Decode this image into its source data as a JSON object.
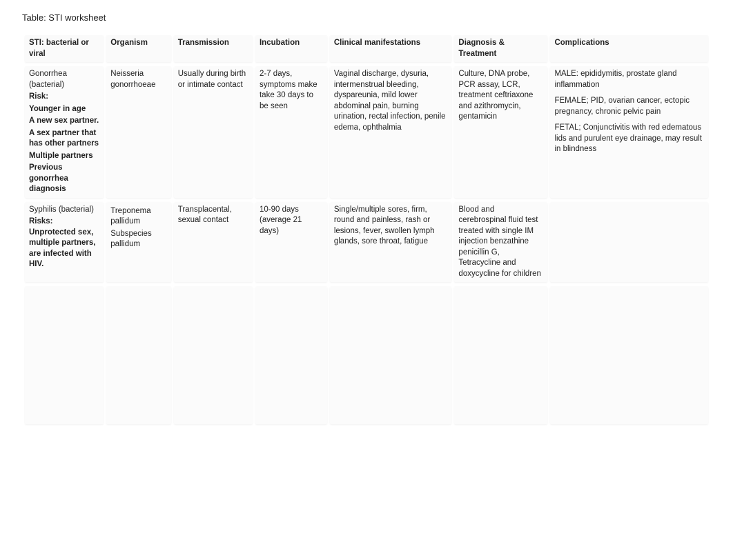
{
  "title": "Table: STI worksheet",
  "headers": {
    "sti": "STI: bacterial or viral",
    "organism": "Organism",
    "transmission": "Transmission",
    "incubation": "Incubation",
    "clinical": "Clinical manifestations",
    "diagnosis": "Diagnosis & Treatment",
    "complications": "Complications"
  },
  "rows": [
    {
      "sti_main": "Gonorrhea (bacterial)",
      "sti_risk_label": "Risk:",
      "sti_risk_1": "Younger in age",
      "sti_risk_2": "A new sex partner.",
      "sti_risk_3": "A sex partner that has other partners",
      "sti_risk_4": "Multiple partners",
      "sti_risk_5": "Previous gonorrhea diagnosis",
      "organism": "Neisseria gonorrhoeae",
      "transmission": "Usually during birth or intimate contact",
      "incubation": "2-7 days, symptoms make take 30 days to be seen",
      "clinical": "Vaginal discharge, dysuria, intermenstrual bleeding, dyspareunia, mild lower abdominal pain, burning urination, rectal infection, penile edema, ophthalmia",
      "diagnosis": "Culture, DNA probe, PCR assay, LCR, treatment ceftriaxone and azithromycin, gentamicin",
      "comp_1": "MALE: epididymitis, prostate gland inflammation",
      "comp_2": "FEMALE; PID, ovarian cancer, ectopic pregnancy, chronic pelvic pain",
      "comp_3": "FETAL; Conjunctivitis with red edematous lids and purulent eye drainage, may result in blindness"
    },
    {
      "sti_main": "Syphilis (bacterial)",
      "sti_risk": " Risks: Unprotected sex, multiple partners, are infected with HIV.",
      "organism_1": "Treponema pallidum",
      "organism_2": "Subspecies pallidum",
      "transmission": "Transplacental, sexual contact",
      "incubation": "10-90 days (average 21 days)",
      "clinical": "Single/multiple sores, firm, round and painless, rash or lesions, fever, swollen lymph glands, sore throat, fatigue",
      "diagnosis": "Blood and cerebrospinal fluid test treated with single IM injection benzathine penicillin G, Tetracycline and doxycycline for children"
    }
  ]
}
